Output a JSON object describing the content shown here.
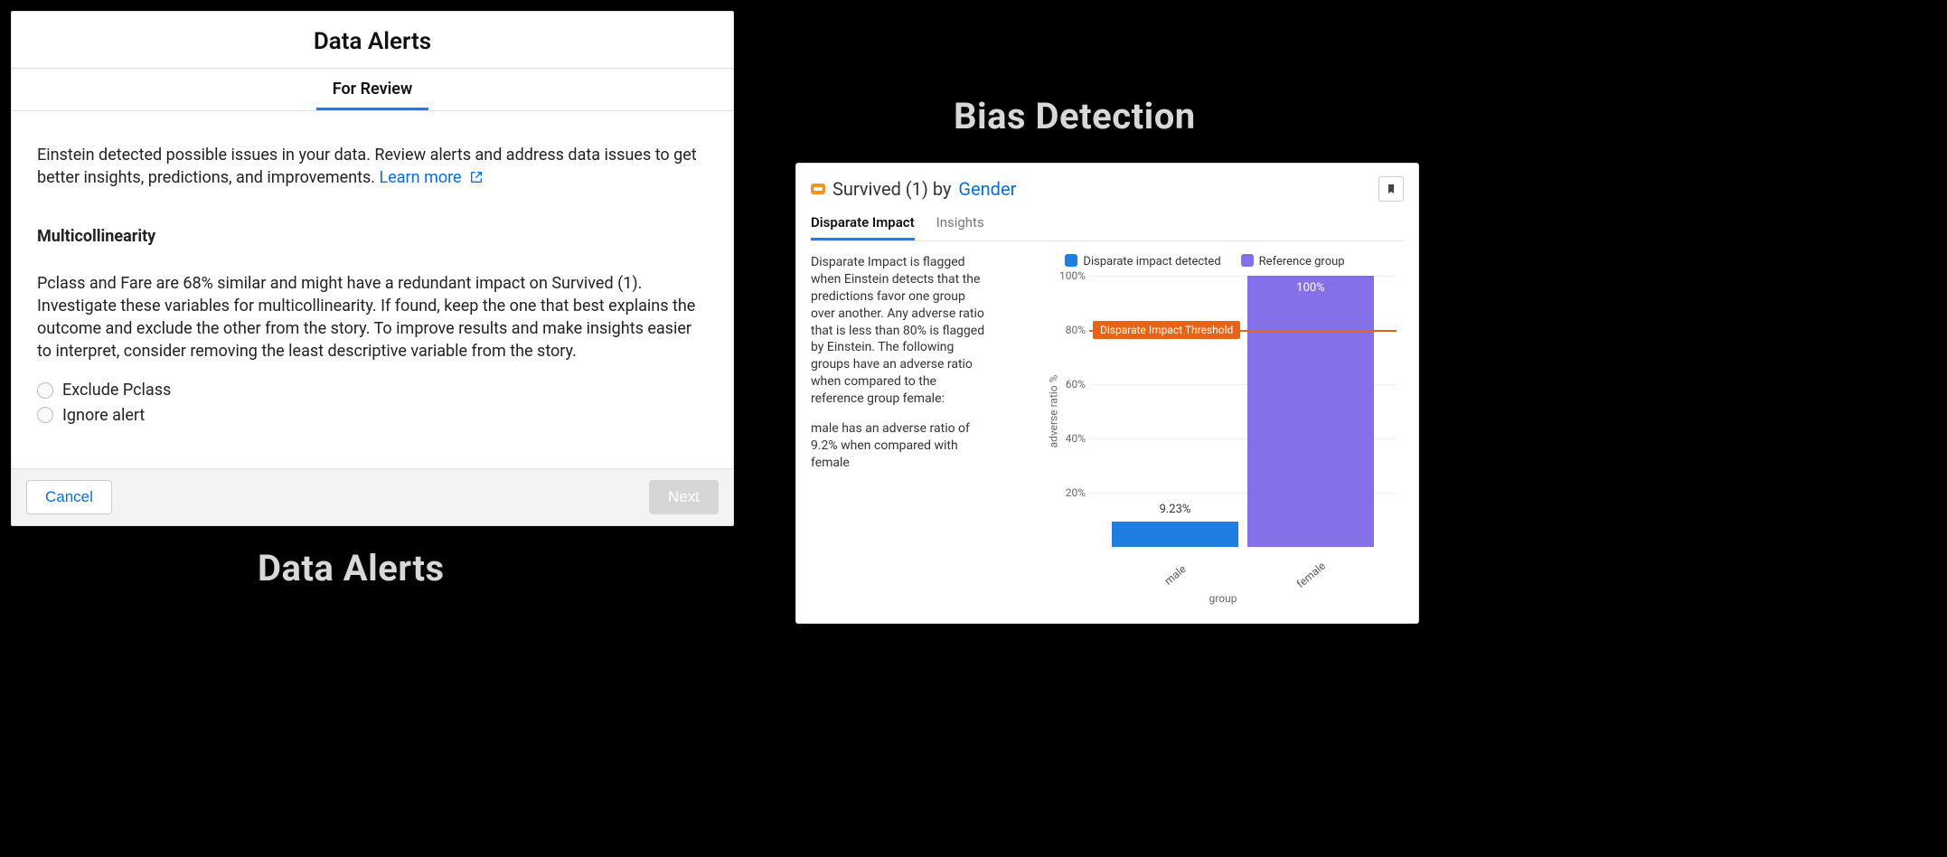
{
  "captions": {
    "left": "Data Alerts",
    "right": "Bias Detection"
  },
  "colors": {
    "accent_blue": "#1b7ef7",
    "bar_detected": "#1f7de0",
    "bar_reference": "#8570e9",
    "threshold": "#e86414"
  },
  "alerts": {
    "title": "Data Alerts",
    "tab": "For Review",
    "intro": "Einstein detected possible issues in your data. Review alerts and address data issues to get better insights, predictions, and improvements.",
    "learn_more": "Learn more",
    "section_title": "Multicollinearity",
    "section_desc": "Pclass and Fare are 68% similar and might have a redundant impact on Survived (1). Investigate these variables for multicollinearity. If found, keep the one that best explains the outcome and exclude the other from the story. To improve results and make insights easier to interpret, consider removing the least descriptive variable from the story.",
    "options": [
      "Exclude Pclass",
      "Ignore alert"
    ],
    "cancel": "Cancel",
    "next": "Next"
  },
  "bias": {
    "title_prefix": "Survived (1) by",
    "title_field": "Gender",
    "tabs": [
      "Disparate Impact",
      "Insights"
    ],
    "active_tab": 0,
    "para1": "Disparate Impact is flagged when Einstein detects that the predictions favor one group over another. Any adverse ratio that is less than 80% is flagged by Einstein. The following groups have an adverse ratio when compared to the reference group female:",
    "para2": "male has an adverse ratio of 9.2% when compared with female",
    "legend": {
      "detected": "Disparate impact detected",
      "reference": "Reference group"
    },
    "threshold_label": "Disparate Impact Threshold"
  },
  "chart_data": {
    "type": "bar",
    "title": "",
    "xlabel": "group",
    "ylabel": "adverse ratio %",
    "ylim": [
      0,
      100
    ],
    "yticks": [
      20,
      40,
      60,
      80,
      100
    ],
    "threshold": 80,
    "series": [
      {
        "name": "Disparate impact detected",
        "color": "#1f7de0"
      },
      {
        "name": "Reference group",
        "color": "#8570e9"
      }
    ],
    "categories": [
      "male",
      "female"
    ],
    "bars": [
      {
        "category": "male",
        "value": 9.23,
        "label": "9.23%",
        "series": 0,
        "label_outside": false
      },
      {
        "category": "female",
        "value": 100,
        "label": "100%",
        "series": 1,
        "label_outside": false
      }
    ]
  }
}
